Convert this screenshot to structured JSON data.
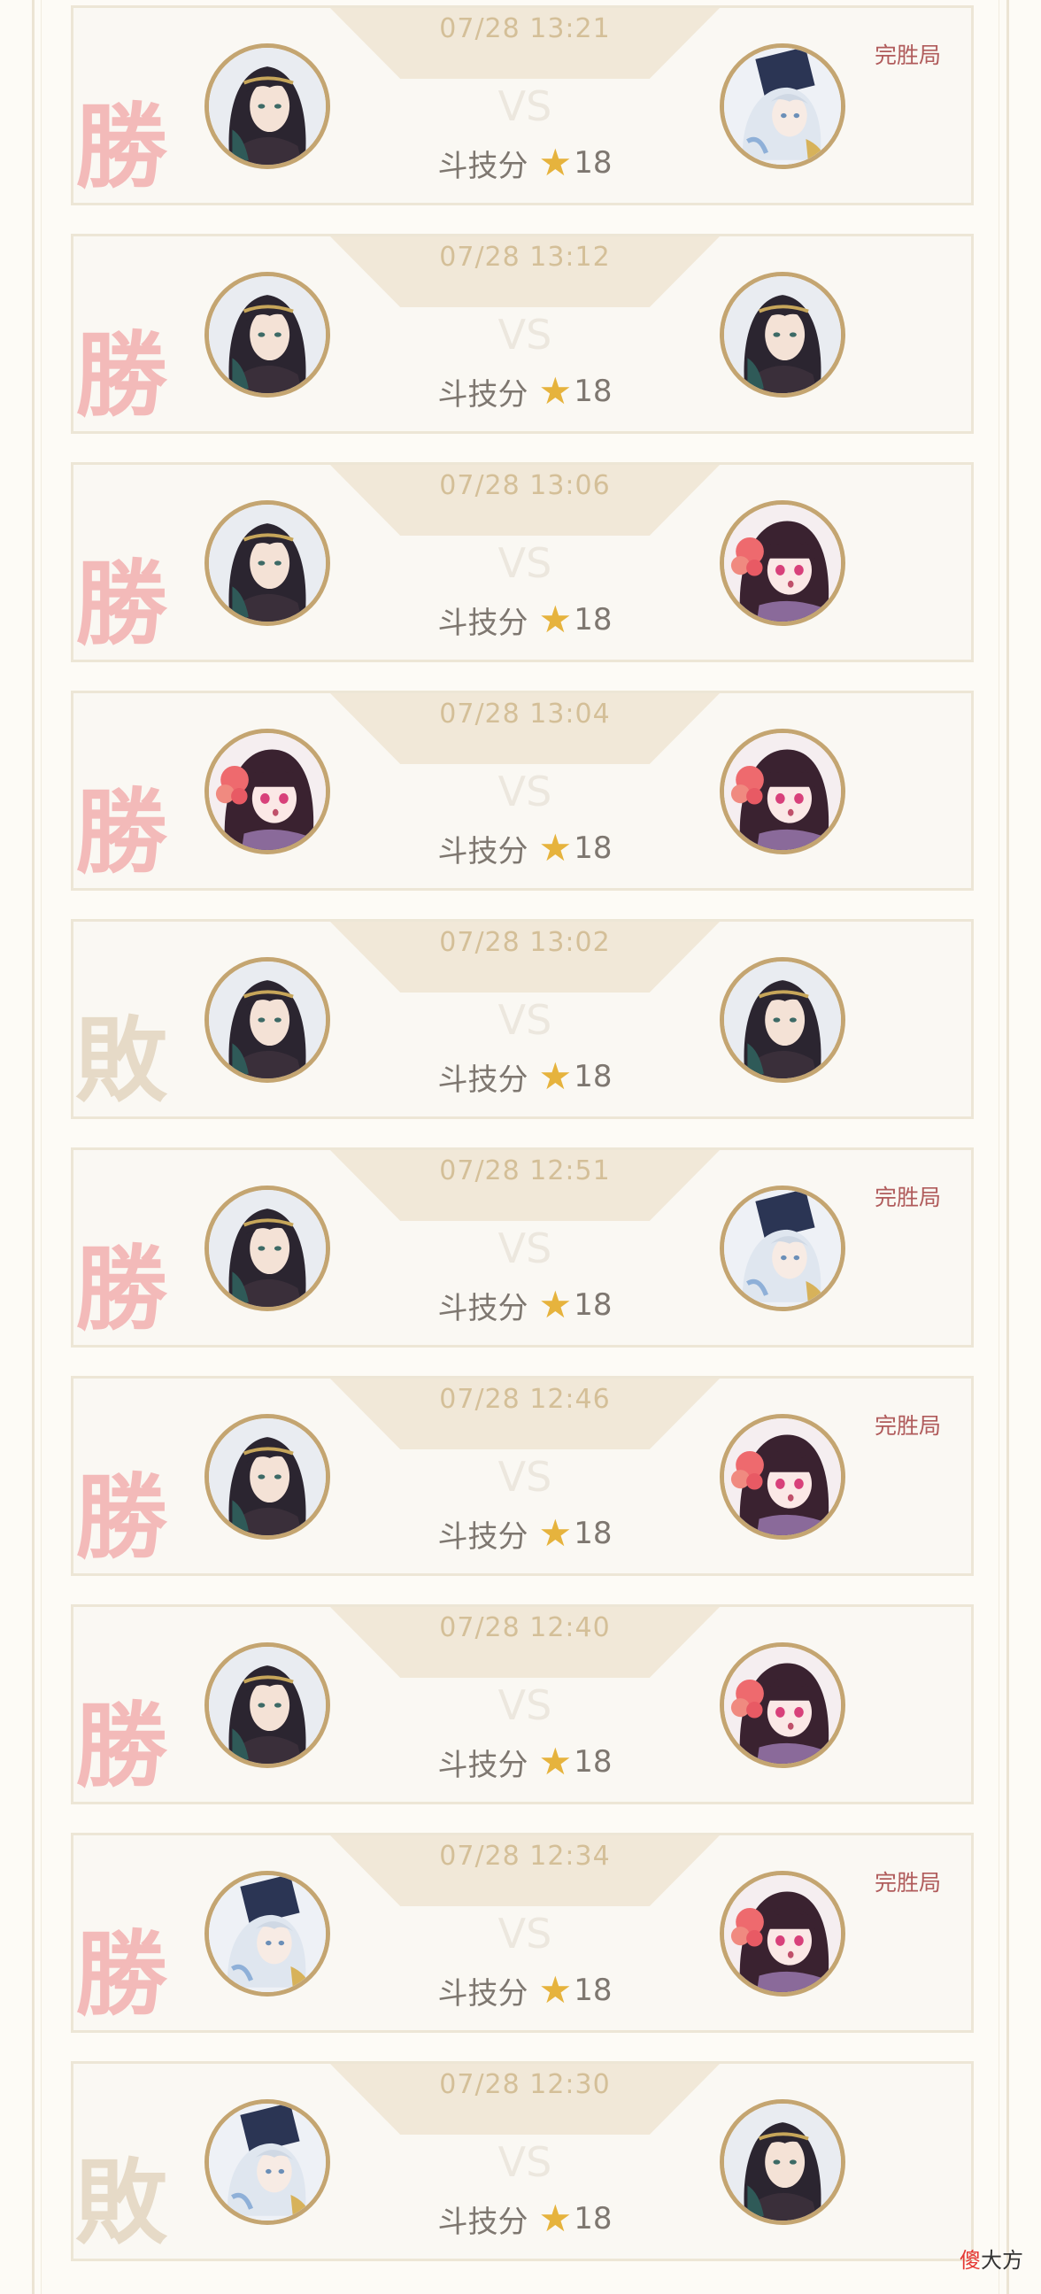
{
  "matches": [
    {
      "time": "07/28 13:21",
      "vs": "VS",
      "score_label": "斗技分",
      "score": "18",
      "result_stamp": "勝",
      "result": "win",
      "perfect": "完胜局",
      "left_avatar": "black-hair-avatar-icon",
      "right_avatar": "white-hair-avatar-icon"
    },
    {
      "time": "07/28 13:12",
      "vs": "VS",
      "score_label": "斗技分",
      "score": "18",
      "result_stamp": "勝",
      "result": "win",
      "perfect": "",
      "left_avatar": "black-hair-avatar-icon",
      "right_avatar": "black-hair-avatar-icon"
    },
    {
      "time": "07/28 13:06",
      "vs": "VS",
      "score_label": "斗技分",
      "score": "18",
      "result_stamp": "勝",
      "result": "win",
      "perfect": "",
      "left_avatar": "black-hair-avatar-icon",
      "right_avatar": "flower-girl-avatar-icon"
    },
    {
      "time": "07/28 13:04",
      "vs": "VS",
      "score_label": "斗技分",
      "score": "18",
      "result_stamp": "勝",
      "result": "win",
      "perfect": "",
      "left_avatar": "flower-girl-avatar-icon",
      "right_avatar": "flower-girl-avatar-icon"
    },
    {
      "time": "07/28 13:02",
      "vs": "VS",
      "score_label": "斗技分",
      "score": "18",
      "result_stamp": "敗",
      "result": "loss",
      "perfect": "",
      "left_avatar": "black-hair-avatar-icon",
      "right_avatar": "black-hair-avatar-icon"
    },
    {
      "time": "07/28 12:51",
      "vs": "VS",
      "score_label": "斗技分",
      "score": "18",
      "result_stamp": "勝",
      "result": "win",
      "perfect": "完胜局",
      "left_avatar": "black-hair-avatar-icon",
      "right_avatar": "white-hair-avatar-icon"
    },
    {
      "time": "07/28 12:46",
      "vs": "VS",
      "score_label": "斗技分",
      "score": "18",
      "result_stamp": "勝",
      "result": "win",
      "perfect": "完胜局",
      "left_avatar": "black-hair-avatar-icon",
      "right_avatar": "flower-girl-avatar-icon"
    },
    {
      "time": "07/28 12:40",
      "vs": "VS",
      "score_label": "斗技分",
      "score": "18",
      "result_stamp": "勝",
      "result": "win",
      "perfect": "",
      "left_avatar": "black-hair-avatar-icon",
      "right_avatar": "flower-girl-avatar-icon"
    },
    {
      "time": "07/28 12:34",
      "vs": "VS",
      "score_label": "斗技分",
      "score": "18",
      "result_stamp": "勝",
      "result": "win",
      "perfect": "完胜局",
      "left_avatar": "white-hair-avatar-icon",
      "right_avatar": "flower-girl-avatar-icon"
    },
    {
      "time": "07/28 12:30",
      "vs": "VS",
      "score_label": "斗技分",
      "score": "18",
      "result_stamp": "敗",
      "result": "loss",
      "perfect": "",
      "left_avatar": "white-hair-avatar-icon",
      "right_avatar": "black-hair-avatar-icon"
    }
  ],
  "icons": {
    "star": "star-icon"
  },
  "colors": {
    "accent_gold": "#c4a571",
    "star": "#e6b33d",
    "win_stamp": "#e8545c",
    "loss_stamp": "#c4a882",
    "perfect_text": "#b05b5b"
  },
  "watermark": {
    "first": "傻",
    "rest": "大方"
  }
}
